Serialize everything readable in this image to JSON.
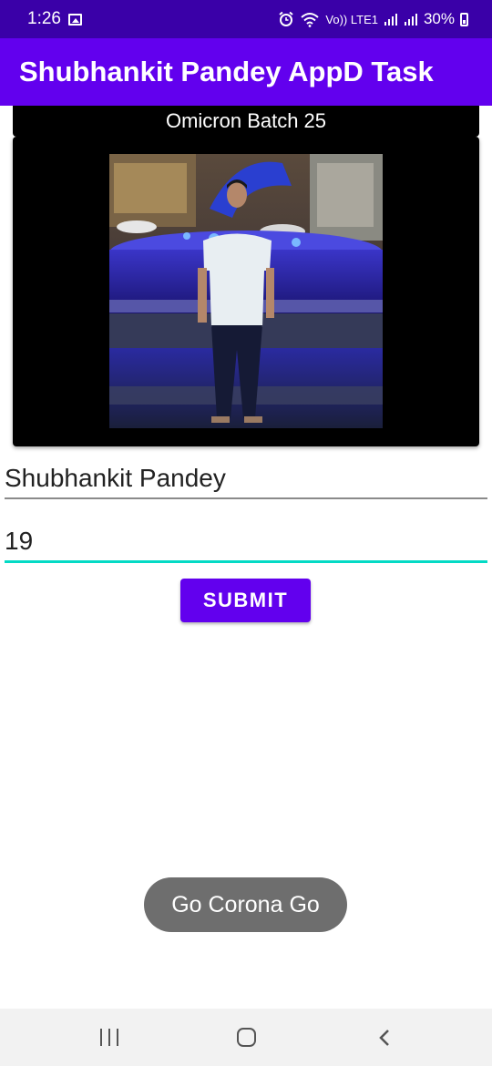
{
  "status_bar": {
    "time": "1:26",
    "network_label": "Vo)) LTE1",
    "battery_text": "30%",
    "icons": [
      "image-icon",
      "alarm-icon",
      "wifi-icon",
      "signal-icon",
      "signal-icon",
      "battery-icon"
    ]
  },
  "app_bar": {
    "title": "Shubhankit Pandey AppD Task"
  },
  "content": {
    "batch_label": "Omicron Batch 25",
    "name_value": "Shubhankit Pandey",
    "age_value": "19",
    "submit_label": "SUBMIT"
  },
  "toast": {
    "message": "Go Corona Go"
  },
  "colors": {
    "status_bar": "#3a00a8",
    "primary": "#6200ee",
    "accent": "#03dac5",
    "toast": "#6e6e6e"
  }
}
